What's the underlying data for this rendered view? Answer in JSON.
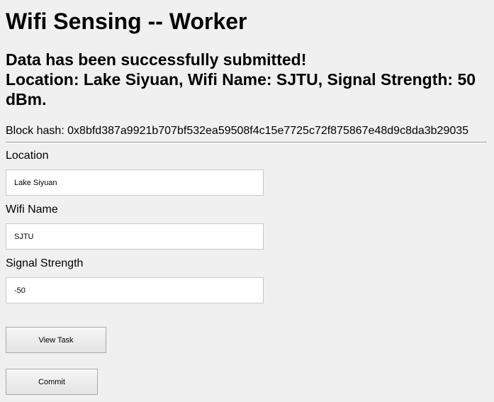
{
  "header": {
    "title": "Wifi Sensing -- Worker"
  },
  "status": {
    "line1": "Data has been successfully submitted!",
    "line2": "Location: Lake Siyuan, Wifi Name: SJTU, Signal Strength: 50 dBm.",
    "block_hash": "Block hash: 0x8bfd387a9921b707bf532ea59508f4c15e7725c72f875867e48d9c8da3b29035"
  },
  "form": {
    "location": {
      "label": "Location",
      "value": "Lake Siyuan"
    },
    "wifi_name": {
      "label": "Wifi Name",
      "value": "SJTU"
    },
    "signal_strength": {
      "label": "Signal Strength",
      "value": "-50"
    }
  },
  "actions": {
    "view_task_label": "View Task",
    "commit_label": "Commit"
  }
}
